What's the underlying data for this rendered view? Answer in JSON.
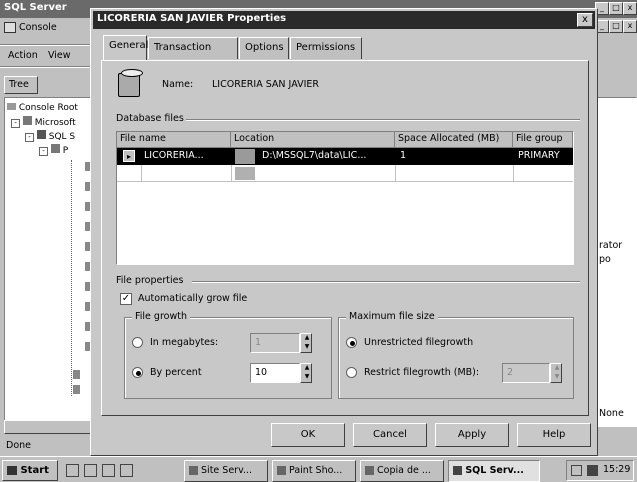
{
  "background_window": {
    "title": "SQL Server",
    "menu": [
      "Console",
      "Action",
      "View"
    ],
    "tree_tab": "Tree",
    "tree_items": [
      "Console Root",
      "Microsoft",
      "SQL S",
      "P"
    ],
    "status": "Done",
    "right_texts": [
      "rator",
      "po",
      "None"
    ]
  },
  "dialog": {
    "title": "LICORERIA SAN JAVIER Properties",
    "close_glyph": "x",
    "tabs": [
      "General",
      "Transaction Log",
      "Options",
      "Permissions"
    ],
    "name_label": "Name:",
    "name_value": "LICORERIA SAN JAVIER",
    "db_files_label": "Database files",
    "columns": [
      "File name",
      "Location",
      "Space Allocated (MB)",
      "File group"
    ],
    "rows": [
      {
        "file_name": "LICORERIA...",
        "location": "D:\\MSSQL7\\data\\LIC...",
        "space": "1",
        "group": "PRIMARY"
      }
    ],
    "file_props_label": "File properties",
    "auto_grow_label": "Automatically grow file",
    "auto_grow_checked": true,
    "file_growth_label": "File growth",
    "in_megabytes_label": "In megabytes:",
    "megabytes_value": "1",
    "by_percent_label": "By percent",
    "percent_value": "10",
    "growth_selected": "percent",
    "max_size_label": "Maximum file size",
    "unrestricted_label": "Unrestricted filegrowth",
    "restrict_label": "Restrict filegrowth (MB):",
    "restrict_value": "2",
    "max_selected": "unrestricted",
    "buttons": {
      "ok": "OK",
      "cancel": "Cancel",
      "apply": "Apply",
      "help": "Help"
    }
  },
  "taskbar": {
    "start": "Start",
    "tasks": [
      "Site Serv...",
      "Paint Sho...",
      "Copia de ...",
      "SQL Serv..."
    ],
    "clock": "15:29"
  }
}
